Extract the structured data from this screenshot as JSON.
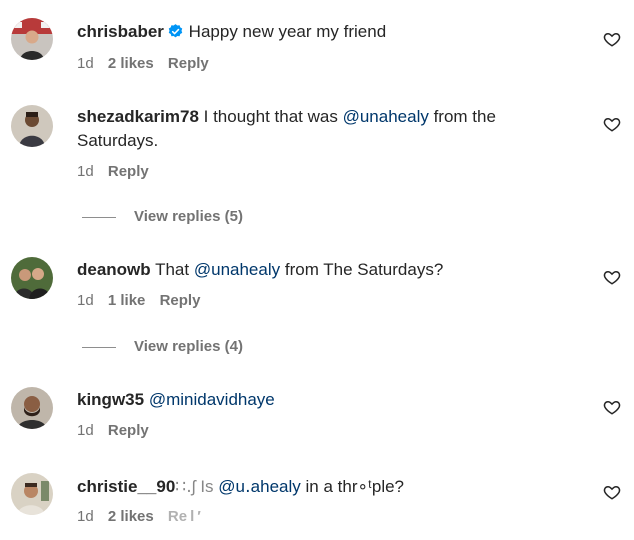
{
  "comments": [
    {
      "username": "chrisbaber",
      "verified": true,
      "text_parts": [
        "Happy new year my friend"
      ],
      "time": "1d",
      "likes": "2 likes",
      "reply": "Reply"
    },
    {
      "username": "shezadkarim78",
      "verified": false,
      "text_before": "I thought that was",
      "mention": "@unahealy",
      "text_after": "from the",
      "text_line2": "Saturdays.",
      "time": "1d",
      "likes": "",
      "reply": "Reply",
      "view_replies": "View replies (5)"
    },
    {
      "username": "deanowb",
      "verified": false,
      "text_before": "That",
      "mention": "@unahealy",
      "text_after": "from The Saturdays?",
      "time": "1d",
      "likes": "1 like",
      "reply": "Reply",
      "view_replies": "View replies (4)"
    },
    {
      "username": "kingw35",
      "verified": false,
      "text_before": "",
      "mention": "@minidavidhaye",
      "text_after": "",
      "time": "1d",
      "likes": "",
      "reply": "Reply"
    },
    {
      "username": "christie__90",
      "username_garbled": "∷․ʃ",
      "verified": false,
      "text_before": "Is",
      "mention": "@u․ahealy",
      "text_after": "in a thr∘ᵗple?",
      "time": "1d",
      "likes": "2 likes",
      "reply": "Re l ′"
    }
  ],
  "icons": {
    "like": "heart-outline-icon",
    "verified": "verified-badge-icon"
  },
  "colors": {
    "text": "#262626",
    "meta": "#737373",
    "mention": "#00376b",
    "verified": "#0095f6"
  }
}
